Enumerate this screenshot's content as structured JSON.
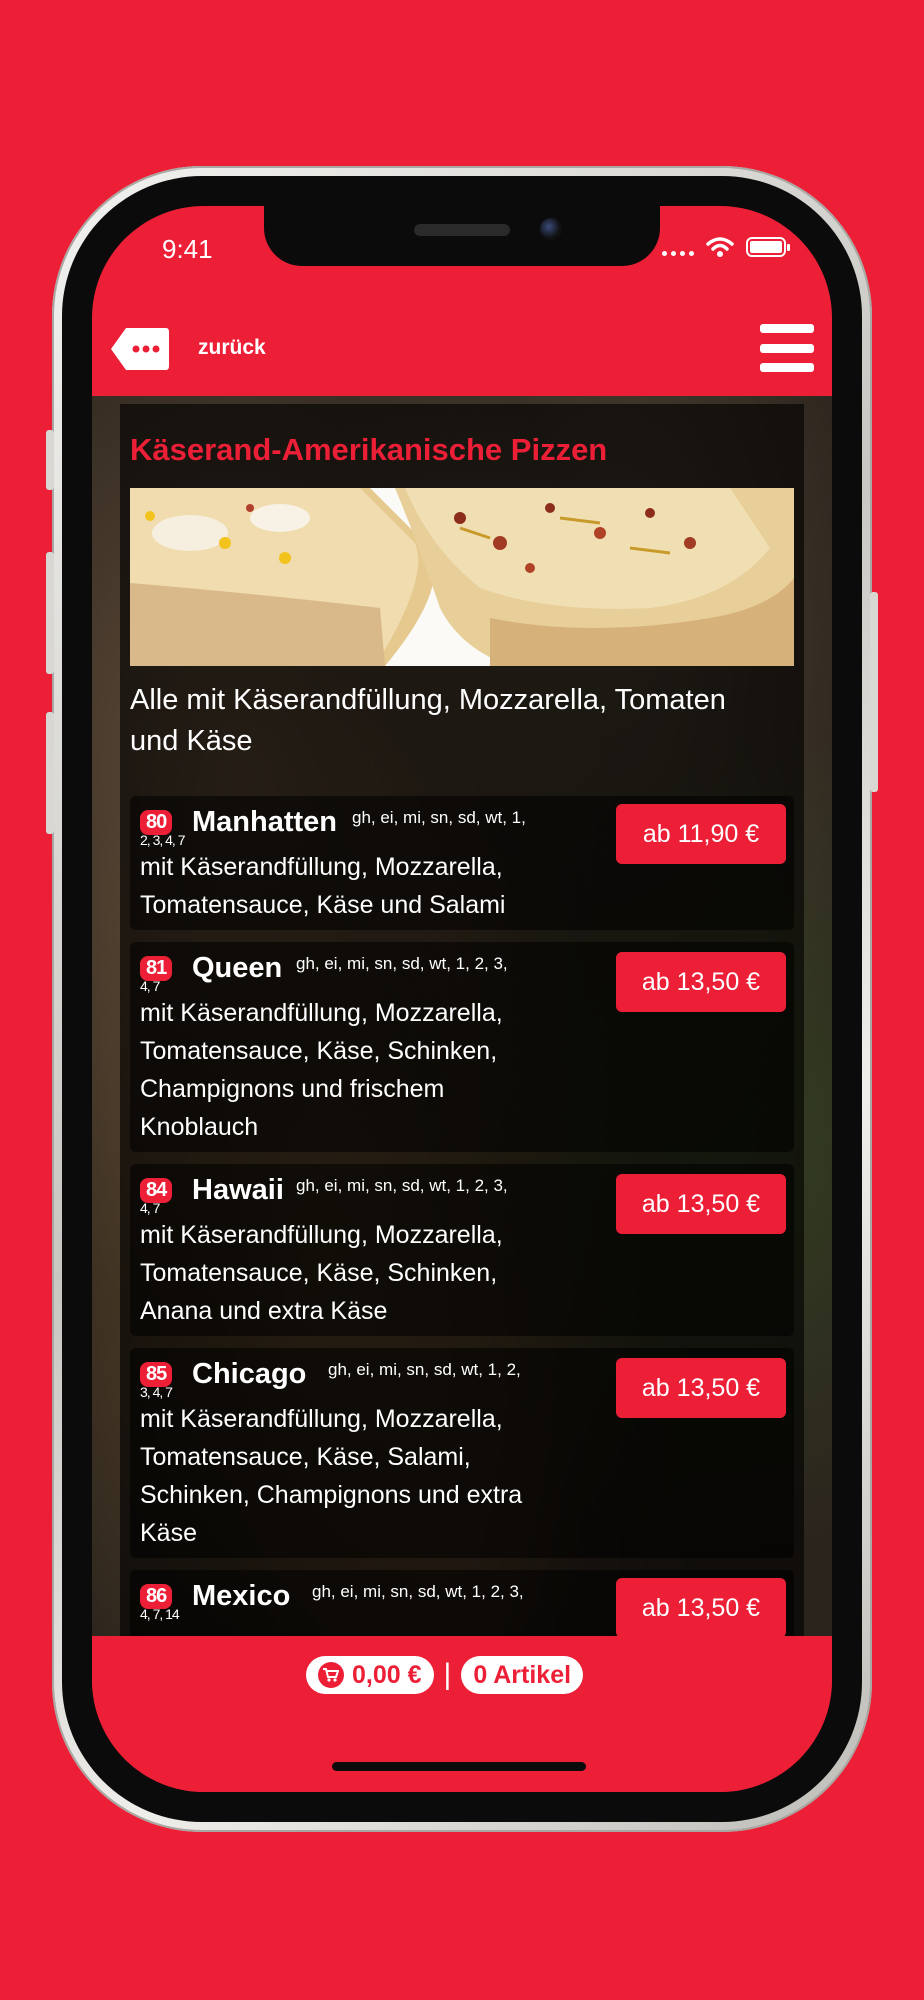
{
  "status_bar": {
    "time": "9:41"
  },
  "header": {
    "back_label": "zurück"
  },
  "category": {
    "title": "Käserand-Amerikanische Pizzen",
    "description": "Alle mit Käserandfüllung, Mozzarella, Tomaten und Käse"
  },
  "items": [
    {
      "number": "80",
      "sub": "2, 3, 4, 7",
      "name": "Manhatten",
      "allergens": "gh, ei, mi, sn, sd, wt, 1,",
      "description": "mit Käserandfüllung, Mozzarella, Tomatensauce, Käse und Salami",
      "price": "ab 11,90 €"
    },
    {
      "number": "81",
      "sub": "4, 7",
      "name": "Queen",
      "allergens": "gh, ei, mi, sn, sd, wt, 1, 2, 3,",
      "description": "mit Käserandfüllung, Mozzarella, Tomatensauce, Käse, Schinken, Champignons und frischem Knoblauch",
      "price": "ab 13,50 €"
    },
    {
      "number": "84",
      "sub": "4, 7",
      "name": "Hawaii",
      "allergens": "gh, ei, mi, sn, sd, wt, 1, 2, 3,",
      "description": "mit Käserandfüllung, Mozzarella, Tomatensauce, Käse, Schinken, Anana und extra Käse",
      "price": "ab 13,50 €"
    },
    {
      "number": "85",
      "sub": "3, 4, 7",
      "name": "Chicago",
      "allergens": "gh, ei, mi, sn, sd, wt, 1, 2,",
      "description": "mit Käserandfüllung, Mozzarella, Tomatensauce, Käse, Salami, Schinken, Champignons und extra Käse",
      "price": "ab 13,50 €"
    },
    {
      "number": "86",
      "sub": "4, 7, 14",
      "name": "Mexico",
      "allergens": "gh, ei, mi, sn, sd, wt, 1, 2, 3,",
      "description": "",
      "price": "ab 13,50 €"
    }
  ],
  "footer": {
    "cart_total": "0,00 €",
    "article_count": "0 Artikel",
    "separator": "|"
  },
  "colors": {
    "brand_red": "#ec1f37",
    "text": "#ffffff"
  },
  "icons": [
    "back-tag-icon",
    "hamburger-menu-icon",
    "cart-icon",
    "wifi-icon",
    "battery-icon"
  ]
}
